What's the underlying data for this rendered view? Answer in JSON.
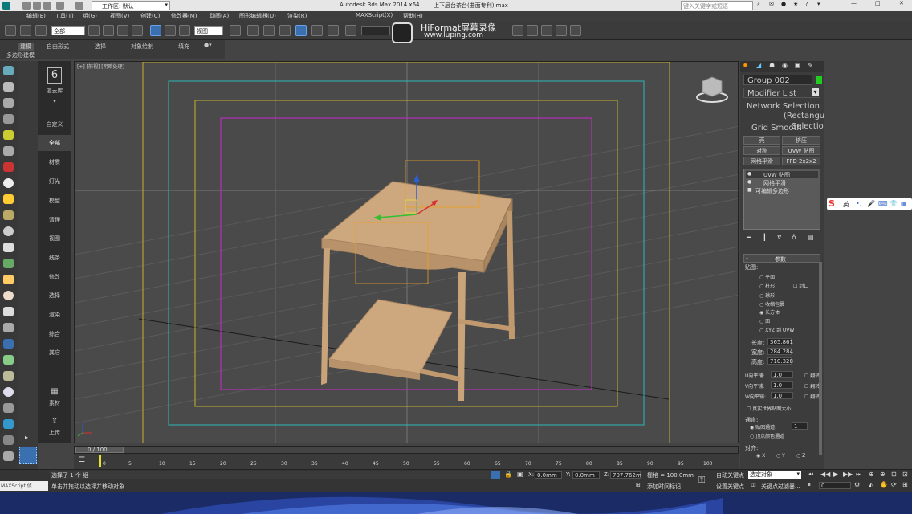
{
  "titlebar": {
    "workspace": "工作区: 默认",
    "title": "Autodesk 3ds Max  2014 x64",
    "file": "上下层台茶台(曲面专利).max",
    "search_placeholder": "键入关键字或短语"
  },
  "menu": [
    "编辑(E)",
    "工具(T)",
    "组(G)",
    "视图(V)",
    "创建(C)",
    "修改器(M)",
    "动画(A)",
    "图形编辑器(D)",
    "渲染(R)",
    "MAXScript(X)",
    "帮助(H)"
  ],
  "toolbar": {
    "selection_filter": "全部",
    "view_dropdown": "视图",
    "watermark_line1": "HiFormat屏幕录像",
    "watermark_line2": "www.luping.com",
    "overlay_text": "录屏软件"
  },
  "ribbon": {
    "tabs": [
      "建模",
      "自由形式",
      "选择",
      "对象绘制",
      "填充"
    ],
    "subtitle": "多边形建模"
  },
  "viewport": {
    "label": "[+] [前视] [明暗处理]",
    "label_plus": "[+]",
    "label_view": "[前视]",
    "label_shading": "[明暗处理]"
  },
  "creator": {
    "counter": "6",
    "cloud_label": "渲云库",
    "items": [
      "自定义",
      "全部",
      "材质",
      "灯光",
      "模型",
      "清理",
      "视图",
      "线条",
      "修改",
      "选择",
      "渲染",
      "综合",
      "其它"
    ],
    "bottom_items": [
      "素材",
      "上传"
    ]
  },
  "command_panel": {
    "object_name": "Group 002",
    "modifier_list": "Modifier List",
    "network_selection": "Network Selection",
    "rect_hint": "(Rectangular",
    "rect_hint2": "Selection)",
    "grid_smooth": "Grid Smooth",
    "buttons": [
      "壳",
      "挤压",
      "对称",
      "UVW 贴图",
      "网格平滑",
      "FFD 2x2x2"
    ],
    "stack": [
      "UVW 贴图",
      "网格平滑",
      "可编辑多边形"
    ],
    "params_title": "参数",
    "mapping_label": "贴图:",
    "mapping_options": [
      "平面",
      "柱形",
      "球形",
      "收缩包裹",
      "长方体",
      "面",
      "XYZ 到 UVW"
    ],
    "cap_label": "封口",
    "length_label": "长度:",
    "length_value": "365.861",
    "width_label": "宽度:",
    "width_value": "284.284",
    "height_label": "高度:",
    "height_value": "710.328",
    "u_tile_label": "U向平铺:",
    "u_tile_value": "1.0",
    "v_tile_label": "V向平铺:",
    "v_tile_value": "1.0",
    "w_tile_label": "W向平铺:",
    "w_tile_value": "1.0",
    "flip_label": "翻转",
    "real_world_label": "真实世界贴图大小",
    "channel_label": "通道:",
    "map_channel_label": "贴图通道:",
    "map_channel_value": "1",
    "vertex_color_label": "顶点颜色通道",
    "align_label": "对齐:",
    "align_options": [
      "X",
      "Y",
      "Z"
    ]
  },
  "ime": {
    "logo": "S",
    "text": "英"
  },
  "timeline": {
    "frame_display": "0 / 100",
    "ticks": [
      "0",
      "5",
      "10",
      "15",
      "20",
      "25",
      "30",
      "35",
      "40",
      "45",
      "50",
      "55",
      "60",
      "65",
      "70",
      "75",
      "80",
      "85",
      "90",
      "95",
      "100"
    ]
  },
  "statusbar": {
    "maxscript_label": "MAXScript 侦",
    "selection_info": "选择了 1 个 组",
    "prompt": "单击并拖动以选择并移动对象",
    "x_label": "X:",
    "x_value": "0.0mm",
    "y_label": "Y:",
    "y_value": "0.0mm",
    "z_label": "Z:",
    "z_value": "707.762m",
    "grid": "栅格 = 100.0mm",
    "add_time_tag": "添加时间标记",
    "auto_key": "自动关键点",
    "set_key": "设置关键点",
    "selected_object": "选定对象",
    "key_filters": "关键点过滤器...",
    "frame": "0"
  },
  "colors": {
    "viewport_bg": "#4a4a4a",
    "safe_yellow": "#c8b030",
    "safe_cyan": "#2fb5b5",
    "safe_magenta": "#b52fb5",
    "wood": "#c8a57c",
    "accent_blue": "#3a6fb0"
  }
}
